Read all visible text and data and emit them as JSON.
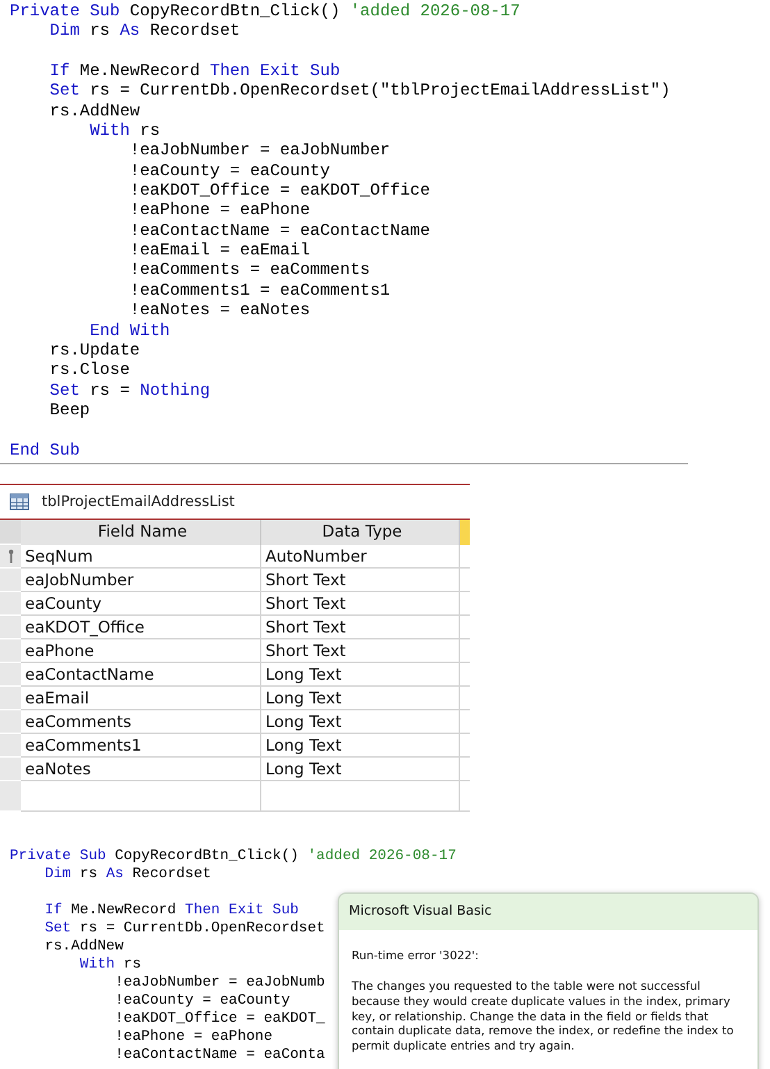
{
  "code_top": {
    "lines": [
      {
        "tokens": [
          {
            "kind": "keyword",
            "text": "Private Sub"
          },
          {
            "kind": "plain",
            "text": " CopyRecordBtn_Click() "
          },
          {
            "kind": "comment",
            "text": "'added 2026-08-17"
          }
        ],
        "children": [
          {
            "tokens": [
              {
                "kind": "keyword",
                "text": "Dim"
              },
              {
                "kind": "plain",
                "text": " rs "
              },
              {
                "kind": "keyword",
                "text": "As"
              },
              {
                "kind": "plain",
                "text": " Recordset"
              }
            ]
          },
          {
            "blank_before": true,
            "tokens": [
              {
                "kind": "keyword",
                "text": "If"
              },
              {
                "kind": "plain",
                "text": " Me.NewRecord "
              },
              {
                "kind": "keyword",
                "text": "Then Exit Sub"
              }
            ]
          },
          {
            "tokens": [
              {
                "kind": "keyword",
                "text": "Set"
              },
              {
                "kind": "plain",
                "text": " rs = CurrentDb.OpenRecordset(\"tblProjectEmailAddressList\")"
              }
            ]
          },
          {
            "tokens": [
              {
                "kind": "plain",
                "text": "rs.AddNew"
              }
            ],
            "children": [
              {
                "tokens": [
                  {
                    "kind": "keyword",
                    "text": "With"
                  },
                  {
                    "kind": "plain",
                    "text": " rs"
                  }
                ],
                "children": [
                  {
                    "tokens": [
                      {
                        "kind": "plain",
                        "text": "!eaJobNumber = eaJobNumber"
                      }
                    ]
                  },
                  {
                    "tokens": [
                      {
                        "kind": "plain",
                        "text": "!eaCounty = eaCounty"
                      }
                    ]
                  },
                  {
                    "tokens": [
                      {
                        "kind": "plain",
                        "text": "!eaKDOT_Office = eaKDOT_Office"
                      }
                    ]
                  },
                  {
                    "tokens": [
                      {
                        "kind": "plain",
                        "text": "!eaPhone = eaPhone"
                      }
                    ]
                  },
                  {
                    "tokens": [
                      {
                        "kind": "plain",
                        "text": "!eaContactName = eaContactName"
                      }
                    ]
                  },
                  {
                    "tokens": [
                      {
                        "kind": "plain",
                        "text": "!eaEmail = eaEmail"
                      }
                    ]
                  },
                  {
                    "tokens": [
                      {
                        "kind": "plain",
                        "text": "!eaComments = eaComments"
                      }
                    ]
                  },
                  {
                    "tokens": [
                      {
                        "kind": "plain",
                        "text": "!eaComments1 = eaComments1"
                      }
                    ]
                  },
                  {
                    "tokens": [
                      {
                        "kind": "plain",
                        "text": "!eaNotes = eaNotes"
                      }
                    ]
                  }
                ]
              },
              {
                "tokens": [
                  {
                    "kind": "keyword",
                    "text": "End With"
                  }
                ]
              }
            ]
          },
          {
            "tokens": [
              {
                "kind": "plain",
                "text": "rs.Update"
              }
            ]
          },
          {
            "tokens": [
              {
                "kind": "plain",
                "text": "rs.Close"
              }
            ]
          },
          {
            "tokens": [
              {
                "kind": "keyword",
                "text": "Set"
              },
              {
                "kind": "plain",
                "text": " rs = "
              },
              {
                "kind": "keyword",
                "text": "Nothing"
              }
            ]
          },
          {
            "tokens": [
              {
                "kind": "plain",
                "text": "Beep"
              }
            ]
          }
        ]
      },
      {
        "blank_before": true,
        "tokens": [
          {
            "kind": "keyword",
            "text": "End Sub"
          }
        ]
      }
    ]
  },
  "table": {
    "title": "tblProjectEmailAddressList",
    "columns": [
      "Field Name",
      "Data Type"
    ],
    "rows": [
      {
        "field": "SeqNum",
        "type": "AutoNumber",
        "primary_key": true
      },
      {
        "field": "eaJobNumber",
        "type": "Short Text",
        "primary_key": false
      },
      {
        "field": "eaCounty",
        "type": "Short Text",
        "primary_key": false
      },
      {
        "field": "eaKDOT_Office",
        "type": "Short Text",
        "primary_key": false
      },
      {
        "field": "eaPhone",
        "type": "Short Text",
        "primary_key": false
      },
      {
        "field": "eaContactName",
        "type": "Long Text",
        "primary_key": false
      },
      {
        "field": "eaEmail",
        "type": "Long Text",
        "primary_key": false
      },
      {
        "field": "eaComments",
        "type": "Long Text",
        "primary_key": false
      },
      {
        "field": "eaComments1",
        "type": "Long Text",
        "primary_key": false
      },
      {
        "field": "eaNotes",
        "type": "Long Text",
        "primary_key": false
      }
    ]
  },
  "code_bottom": {
    "lines": [
      {
        "tokens": [
          {
            "kind": "keyword",
            "text": "Private Sub"
          },
          {
            "kind": "plain",
            "text": " CopyRecordBtn_Click() "
          },
          {
            "kind": "comment",
            "text": "'added 2026-08-17"
          }
        ],
        "children": [
          {
            "tokens": [
              {
                "kind": "keyword",
                "text": "Dim"
              },
              {
                "kind": "plain",
                "text": " rs "
              },
              {
                "kind": "keyword",
                "text": "As"
              },
              {
                "kind": "plain",
                "text": " Recordset"
              }
            ]
          },
          {
            "blank_before": true,
            "tokens": [
              {
                "kind": "keyword",
                "text": "If"
              },
              {
                "kind": "plain",
                "text": " Me.NewRecord "
              },
              {
                "kind": "keyword",
                "text": "Then Exit Sub"
              }
            ]
          },
          {
            "tokens": [
              {
                "kind": "keyword",
                "text": "Set"
              },
              {
                "kind": "plain",
                "text": " rs = CurrentDb.OpenRecordset"
              }
            ]
          },
          {
            "tokens": [
              {
                "kind": "plain",
                "text": "rs.AddNew"
              }
            ],
            "children": [
              {
                "tokens": [
                  {
                    "kind": "keyword",
                    "text": "With"
                  },
                  {
                    "kind": "plain",
                    "text": " rs"
                  }
                ],
                "children": [
                  {
                    "tokens": [
                      {
                        "kind": "plain",
                        "text": "!eaJobNumber = eaJobNumb"
                      }
                    ]
                  },
                  {
                    "tokens": [
                      {
                        "kind": "plain",
                        "text": "!eaCounty = eaCounty"
                      }
                    ]
                  },
                  {
                    "tokens": [
                      {
                        "kind": "plain",
                        "text": "!eaKDOT_Office = eaKDOT_"
                      }
                    ]
                  },
                  {
                    "tokens": [
                      {
                        "kind": "plain",
                        "text": "!eaPhone = eaPhone"
                      }
                    ]
                  },
                  {
                    "tokens": [
                      {
                        "kind": "plain",
                        "text": "!eaContactName = eaConta"
                      }
                    ]
                  }
                ]
              }
            ]
          }
        ]
      }
    ]
  },
  "dialog": {
    "title": "Microsoft Visual Basic",
    "error": "Run-time error '3022':",
    "message": "The changes you requested to the table were not successful because they would create duplicate values in the index, primary key, or relationship. Change the data in the field or fields that contain duplicate data, remove the index, or redefine the index to permit duplicate entries and try again."
  }
}
